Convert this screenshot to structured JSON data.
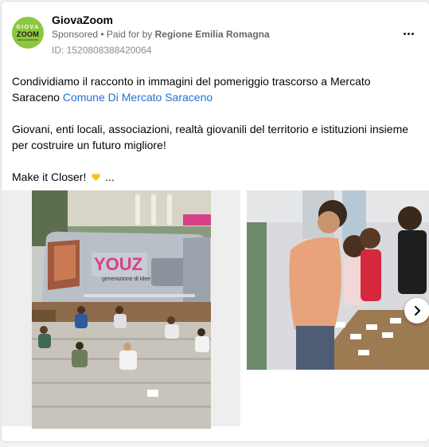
{
  "post": {
    "page_name": "GiovaZoom",
    "sponsored_label": "Sponsored",
    "separator": " • ",
    "paid_for_prefix": "Paid for by ",
    "payer": "Regione Emilia Romagna",
    "ad_id": "ID: 1520808388420064",
    "avatar": {
      "line1": "GIOVA",
      "line2": "ZOOM",
      "line3": "EMILIA-ROMAGNA",
      "color": "#8dc63f"
    },
    "text": {
      "p1_prefix": "Condividiamo il racconto in immagini del pomeriggio trascorso a Mercato Saraceno ",
      "p1_link": "Comune Di Mercato Saraceno",
      "p2": "Giovani, enti locali, associazioni, realtà giovanili del territorio e istituzioni insieme per costruire un futuro migliore!",
      "p3_prefix": "Make it Closer! ",
      "p3_suffix": " ..."
    },
    "media": {
      "slide1_sign": "YOUZ",
      "slide1_sign_sub": "generazione di idee"
    },
    "icons": {
      "more": "more-options-icon",
      "heart": "yellow-heart-icon",
      "next": "chevron-right-icon"
    },
    "colors": {
      "link": "#216fdb",
      "muted": "#65676b",
      "heart": "#f7c31c"
    }
  }
}
